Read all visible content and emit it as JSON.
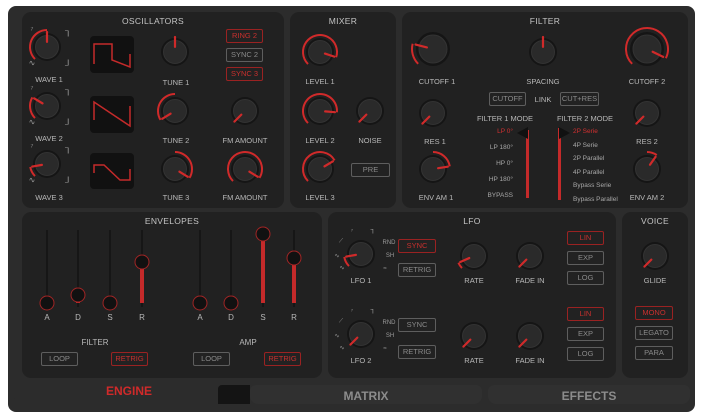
{
  "colors": {
    "accent": "#d02a2a",
    "panel": "#212121",
    "bg": "#2c2c2c"
  },
  "oscillators": {
    "title": "OSCILLATORS",
    "knobs": [
      {
        "label": "WAVE 1",
        "value": 0.5,
        "bipolar": false
      },
      {
        "label": "WAVE 2",
        "value": 0.28,
        "bipolar": false
      },
      {
        "label": "WAVE 3",
        "value": 0.13,
        "bipolar": false
      },
      {
        "label": "TUNE 1",
        "value": 0.5,
        "bipolar": true
      },
      {
        "label": "TUNE 2",
        "value": 0.05,
        "bipolar": true
      },
      {
        "label": "TUNE 3",
        "value": 0.95,
        "bipolar": true
      },
      {
        "label": "FM AMOUNT",
        "value": 0.0,
        "bipolar": false
      },
      {
        "label": "FM AMOUNT",
        "value": 0.95,
        "bipolar": false
      }
    ],
    "buttons": [
      {
        "label": "RING 2",
        "active": true
      },
      {
        "label": "SYNC 2",
        "active": false
      },
      {
        "label": "SYNC 3",
        "active": true
      }
    ]
  },
  "mixer": {
    "title": "MIXER",
    "knobs": [
      {
        "label": "LEVEL 1",
        "value": 0.9,
        "bipolar": false
      },
      {
        "label": "LEVEL 2",
        "value": 0.85,
        "bipolar": false
      },
      {
        "label": "NOISE",
        "value": 0.0,
        "bipolar": false
      },
      {
        "label": "LEVEL 3",
        "value": 0.72,
        "bipolar": false
      }
    ],
    "pre_button": {
      "label": "PRE",
      "active": false
    }
  },
  "filter": {
    "title": "FILTER",
    "knobs": [
      {
        "label": "CUTOFF 1",
        "value": 0.22,
        "bipolar": false
      },
      {
        "label": "SPACING",
        "value": 0.5,
        "bipolar": true
      },
      {
        "label": "CUTOFF 2",
        "value": 0.93,
        "bipolar": false
      },
      {
        "label": "RES 1",
        "value": 0.0,
        "bipolar": false
      },
      {
        "label": "ENV AM 1",
        "value": 0.8,
        "bipolar": true
      },
      {
        "label": "RES 2",
        "value": 0.0,
        "bipolar": false
      },
      {
        "label": "ENV AM 2",
        "value": 0.63,
        "bipolar": true
      }
    ],
    "link_label": "LINK",
    "link_buttons": [
      {
        "label": "CUTOFF",
        "active": false
      },
      {
        "label": "CUT+RES",
        "active": false
      }
    ],
    "mode1": {
      "label": "FILTER 1 MODE",
      "options": [
        "LP 0°",
        "LP 180°",
        "HP 0°",
        "HP 180°",
        "BYPASS"
      ],
      "selected": 0
    },
    "mode2": {
      "label": "FILTER 2 MODE",
      "options": [
        "2P Serie",
        "4P Serie",
        "2P Parallel",
        "4P Parallel",
        "Bypass Serie",
        "Bypass Parallel"
      ],
      "selected": 0
    }
  },
  "envelopes": {
    "title": "ENVELOPES",
    "filter": {
      "label": "FILTER",
      "sliders": [
        {
          "label": "A",
          "value": 0.0
        },
        {
          "label": "D",
          "value": 0.12
        },
        {
          "label": "S",
          "value": 0.0
        },
        {
          "label": "R",
          "value": 0.6
        }
      ],
      "loop": {
        "label": "LOOP",
        "active": false
      },
      "retrig": {
        "label": "RETRIG",
        "active": true
      }
    },
    "amp": {
      "label": "AMP",
      "sliders": [
        {
          "label": "A",
          "value": 0.0
        },
        {
          "label": "D",
          "value": 0.0
        },
        {
          "label": "S",
          "value": 1.0
        },
        {
          "label": "R",
          "value": 0.65
        }
      ],
      "loop": {
        "label": "LOOP",
        "active": false
      },
      "retrig": {
        "label": "RETRIG",
        "active": true
      }
    }
  },
  "lfo": {
    "title": "LFO",
    "glyph_rnd": "RND",
    "glyph_sh": "SH",
    "rows": [
      {
        "knobs": [
          {
            "label": "LFO 1",
            "value": 0.13,
            "bipolar": false
          },
          {
            "label": "RATE",
            "value": 0.08,
            "bipolar": false
          },
          {
            "label": "FADE IN",
            "value": 0.0,
            "bipolar": false
          }
        ],
        "sync": {
          "label": "SYNC",
          "active": true
        },
        "retrig": {
          "label": "RETRIG",
          "active": false
        },
        "curves": [
          {
            "label": "LIN",
            "active": true
          },
          {
            "label": "EXP",
            "active": false
          },
          {
            "label": "LOG",
            "active": false
          }
        ]
      },
      {
        "knobs": [
          {
            "label": "LFO 2",
            "value": 0.0,
            "bipolar": false
          },
          {
            "label": "RATE",
            "value": 0.0,
            "bipolar": false
          },
          {
            "label": "FADE IN",
            "value": 0.0,
            "bipolar": false
          }
        ],
        "sync": {
          "label": "SYNC",
          "active": false
        },
        "retrig": {
          "label": "RETRIG",
          "active": false
        },
        "curves": [
          {
            "label": "LIN",
            "active": true
          },
          {
            "label": "EXP",
            "active": false
          },
          {
            "label": "LOG",
            "active": false
          }
        ]
      }
    ]
  },
  "voice": {
    "title": "VOICE",
    "knob": {
      "label": "GLIDE",
      "value": 0.0,
      "bipolar": false
    },
    "modes": [
      {
        "label": "MONO",
        "active": true
      },
      {
        "label": "LEGATO",
        "active": false
      },
      {
        "label": "PARA",
        "active": false
      }
    ]
  },
  "tabs": [
    {
      "label": "ENGINE",
      "active": true
    },
    {
      "label": "MATRIX",
      "active": false
    },
    {
      "label": "EFFECTS",
      "active": false
    }
  ]
}
